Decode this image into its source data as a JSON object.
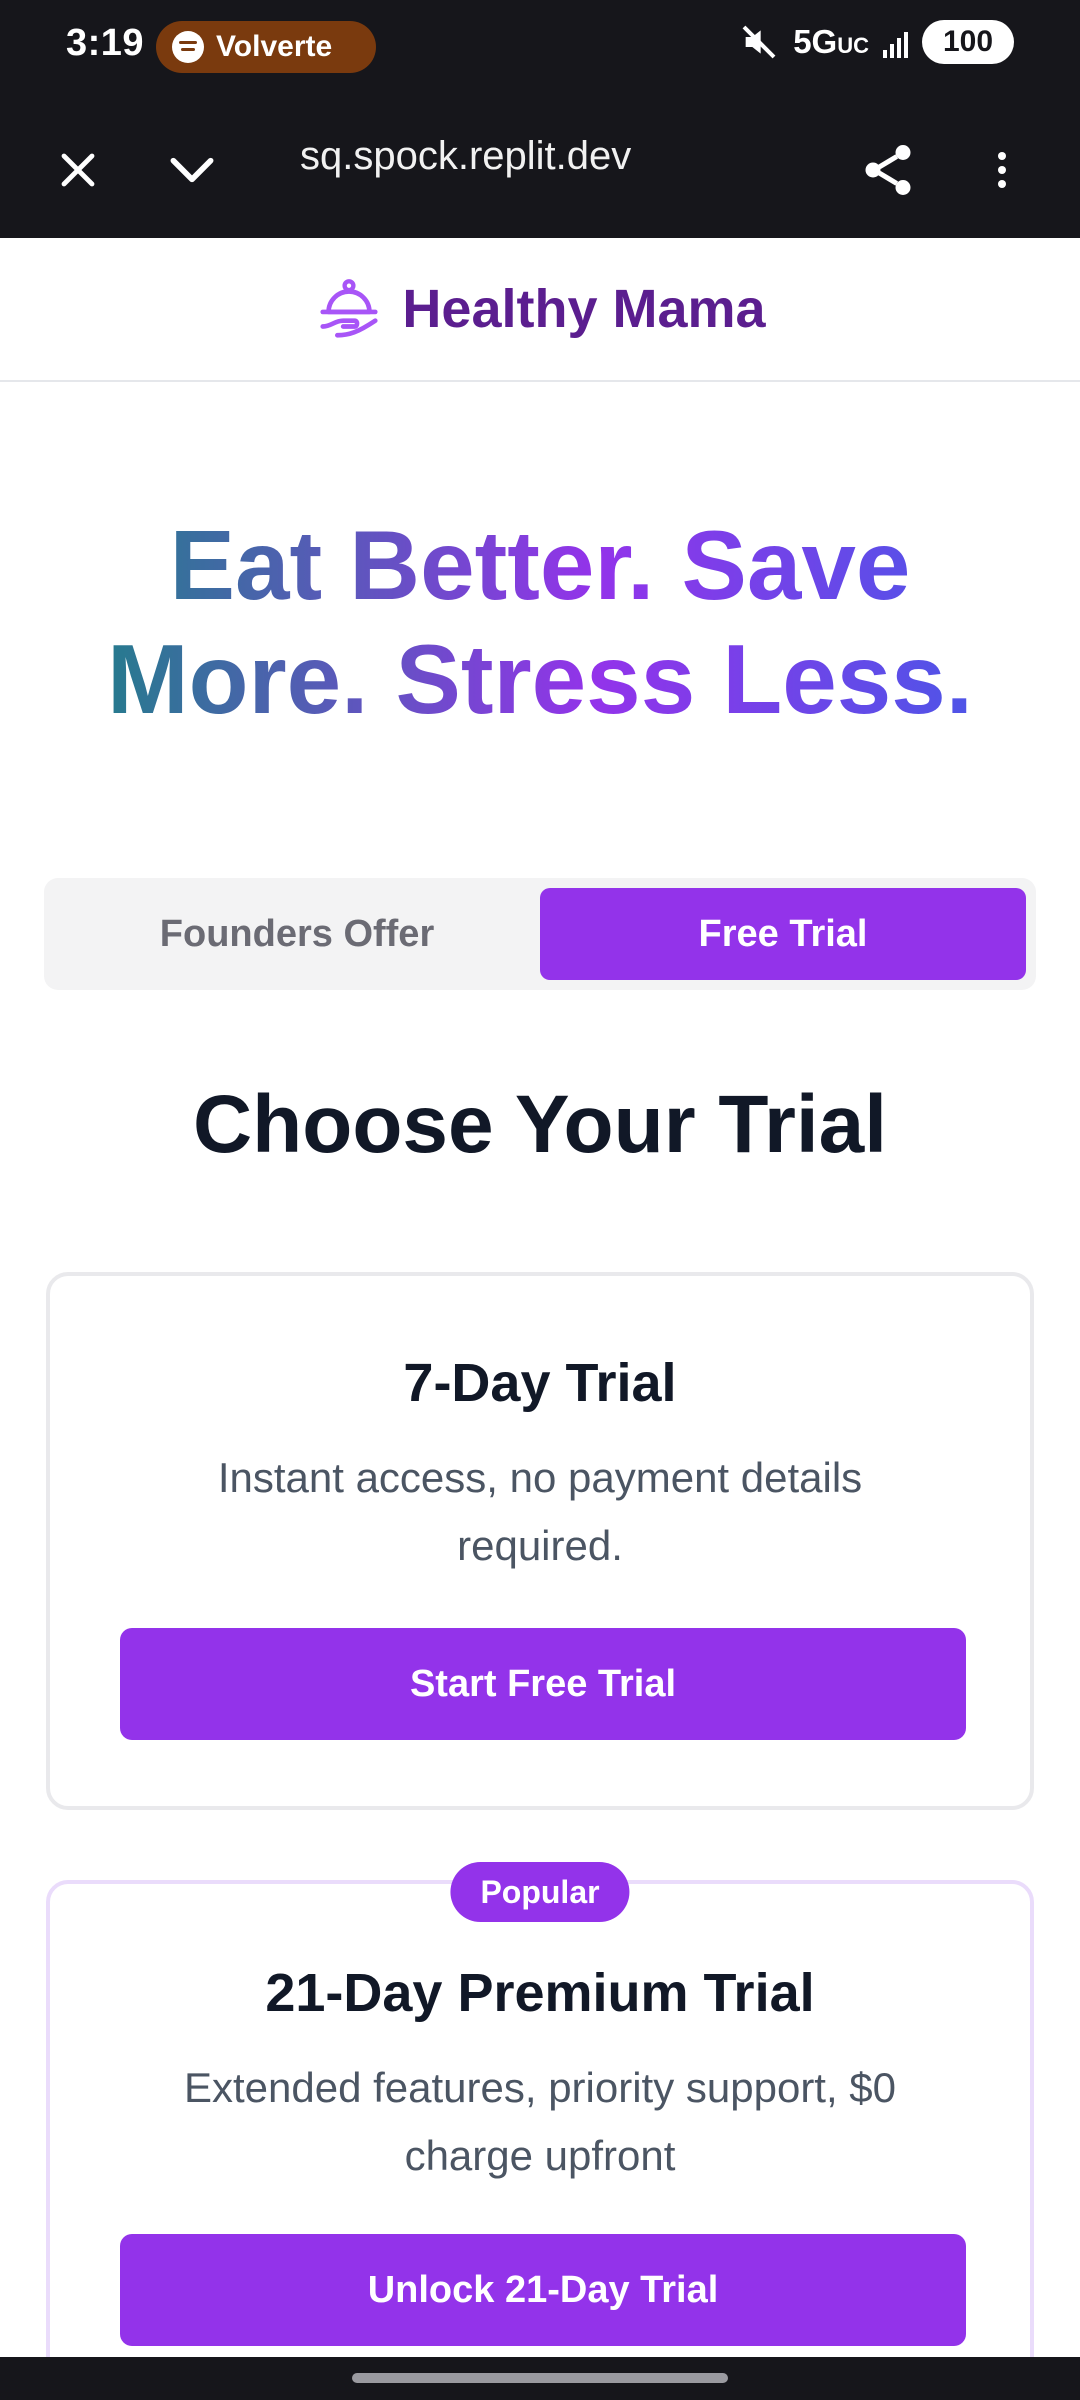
{
  "status_bar": {
    "time": "3:19",
    "media_app": "Volverte",
    "network": "5G",
    "network_suffix": "UC",
    "battery": "100"
  },
  "browser": {
    "url": "sq.spock.replit.dev"
  },
  "header": {
    "brand": "Healthy Mama"
  },
  "hero": {
    "line1_a": "Eat Better. Save",
    "line2_a": "More. Stress Less."
  },
  "toggle": {
    "options": [
      "Founders Offer",
      "Free Trial"
    ],
    "active": "Free Trial"
  },
  "section": {
    "title": "Choose Your Trial"
  },
  "cards": [
    {
      "title": "7-Day Trial",
      "description": "Instant access, no payment details required.",
      "button": "Start Free Trial"
    },
    {
      "badge": "Popular",
      "title": "21-Day Premium Trial",
      "description": "Extended features, priority support, $0 charge upfront",
      "button": "Unlock 21-Day Trial"
    }
  ],
  "colors": {
    "accent": "#9333ea",
    "brand_text": "#5b1e8f",
    "chrome": "#16161b"
  }
}
